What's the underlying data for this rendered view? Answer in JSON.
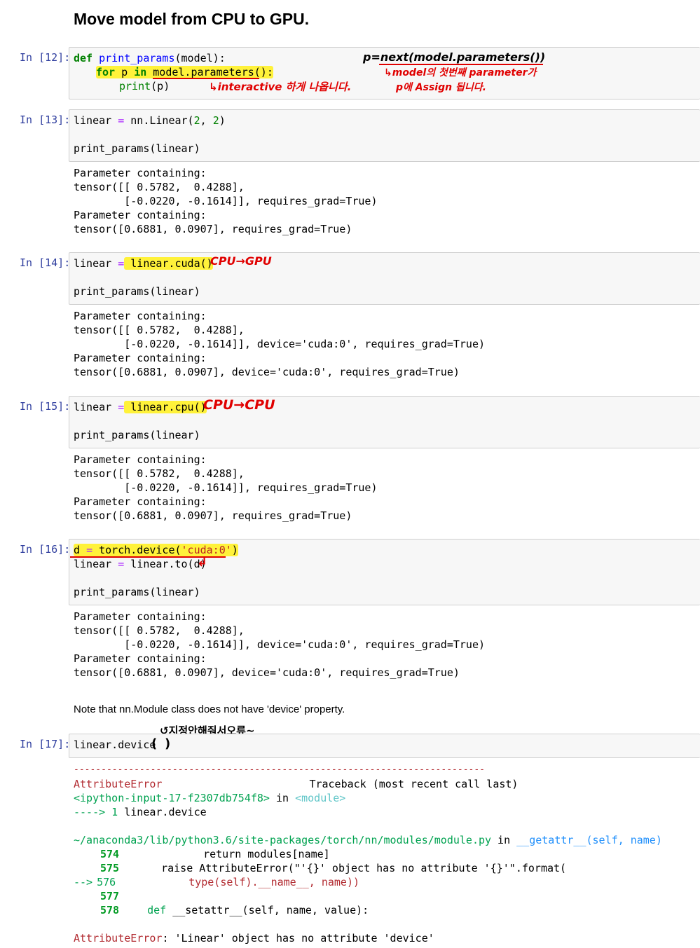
{
  "title": "Move model from CPU to GPU.",
  "cells": {
    "c12": {
      "prompt": "In [12]:",
      "l1a": "def",
      "l1b": "print_params",
      "l1c": "(model):",
      "l2a": "for",
      "l2b": " p ",
      "l2c": "in",
      "l2d": " model.parameters():",
      "l3a": "print",
      "l3b": "(p)"
    },
    "c13": {
      "prompt": "In [13]:",
      "l1a": "linear ",
      "l1b": "=",
      "l1c": " nn.Linear(",
      "l1d": "2",
      "l1e": ", ",
      "l1f": "2",
      "l1g": ")",
      "l2": "print_params(linear)"
    },
    "c14": {
      "prompt": "In [14]:",
      "l1a": "linear ",
      "l1b": "=",
      "l1c": " linear.cuda()",
      "l2": "print_params(linear)"
    },
    "c15": {
      "prompt": "In [15]:",
      "l1a": "linear ",
      "l1b": "=",
      "l1c": " linear.cpu()",
      "l2": "print_params(linear)"
    },
    "c16": {
      "prompt": "In [16]:",
      "l1a": "d ",
      "l1b": "=",
      "l1c": " torch.device(",
      "l1d": "'cuda:0'",
      "l1e": ")",
      "l2a": "linear ",
      "l2b": "=",
      "l2c": " linear.to(d)",
      "l3": "print_params(linear)"
    },
    "c17": {
      "prompt": "In [17]:",
      "l1": "linear.device"
    }
  },
  "outputs": {
    "o13": [
      "Parameter containing:",
      "tensor([[ 0.5782,  0.4288],",
      "        [-0.0220, -0.1614]], requires_grad=True)",
      "Parameter containing:",
      "tensor([0.6881, 0.0907], requires_grad=True)"
    ],
    "o14": [
      "Parameter containing:",
      "tensor([[ 0.5782,  0.4288],",
      "        [-0.0220, -0.1614]], device='cuda:0', requires_grad=True)",
      "Parameter containing:",
      "tensor([0.6881, 0.0907], device='cuda:0', requires_grad=True)"
    ],
    "o15": [
      "Parameter containing:",
      "tensor([[ 0.5782,  0.4288],",
      "        [-0.0220, -0.1614]], requires_grad=True)",
      "Parameter containing:",
      "tensor([0.6881, 0.0907], requires_grad=True)"
    ],
    "o16": [
      "Parameter containing:",
      "tensor([[ 0.5782,  0.4288],",
      "        [-0.0220, -0.1614]], device='cuda:0', requires_grad=True)",
      "Parameter containing:",
      "tensor([0.6881, 0.0907], device='cuda:0', requires_grad=True)"
    ]
  },
  "note": "Note that nn.Module class does not have 'device' property.",
  "traceback": {
    "dashes": "---------------------------------------------------------------------------",
    "err_name": "AttributeError",
    "tb_label": "Traceback (most recent call last)",
    "input_ref": "<ipython-input-17-f2307db754f8>",
    "in_word": " in ",
    "module_ref": "<module>",
    "arrow1": "----> 1",
    "arrow1_code": " linear.device",
    "path": "~/anaconda3/lib/python3.6/site-packages/torch/nn/modules/module.py",
    "getattr_ref": "__getattr__(self, name)",
    "n574": "574",
    "c574": "return modules[name]",
    "n575": "575",
    "c575": "raise AttributeError(\"'{}' object has no attribute '{}'\".format(",
    "arrow576": "-->",
    "n576": "576",
    "c576": "type(self).__name__, name))",
    "n577": "577",
    "n578": "578",
    "c578a": "def",
    "c578b": " __setattr__(self, name, value):",
    "final_name": "AttributeError",
    "final_msg": ": 'Linear' object has no attribute 'device'"
  },
  "annotations": {
    "a12_interactive": "↳interactive 하게 나옵니다.",
    "a12_next": "p=next(model.parameters())",
    "a12_first": "↳model의 첫번째 parameter가",
    "a12_assign": "p에 Assign 됩니다.",
    "a14": "CPU→GPU",
    "a15": "CPU→CPU",
    "a16_arrow": "↲",
    "a17_paren_l": "(",
    "a17_paren_r": ")",
    "a17_note": "↺지정안해줘서오류~"
  }
}
